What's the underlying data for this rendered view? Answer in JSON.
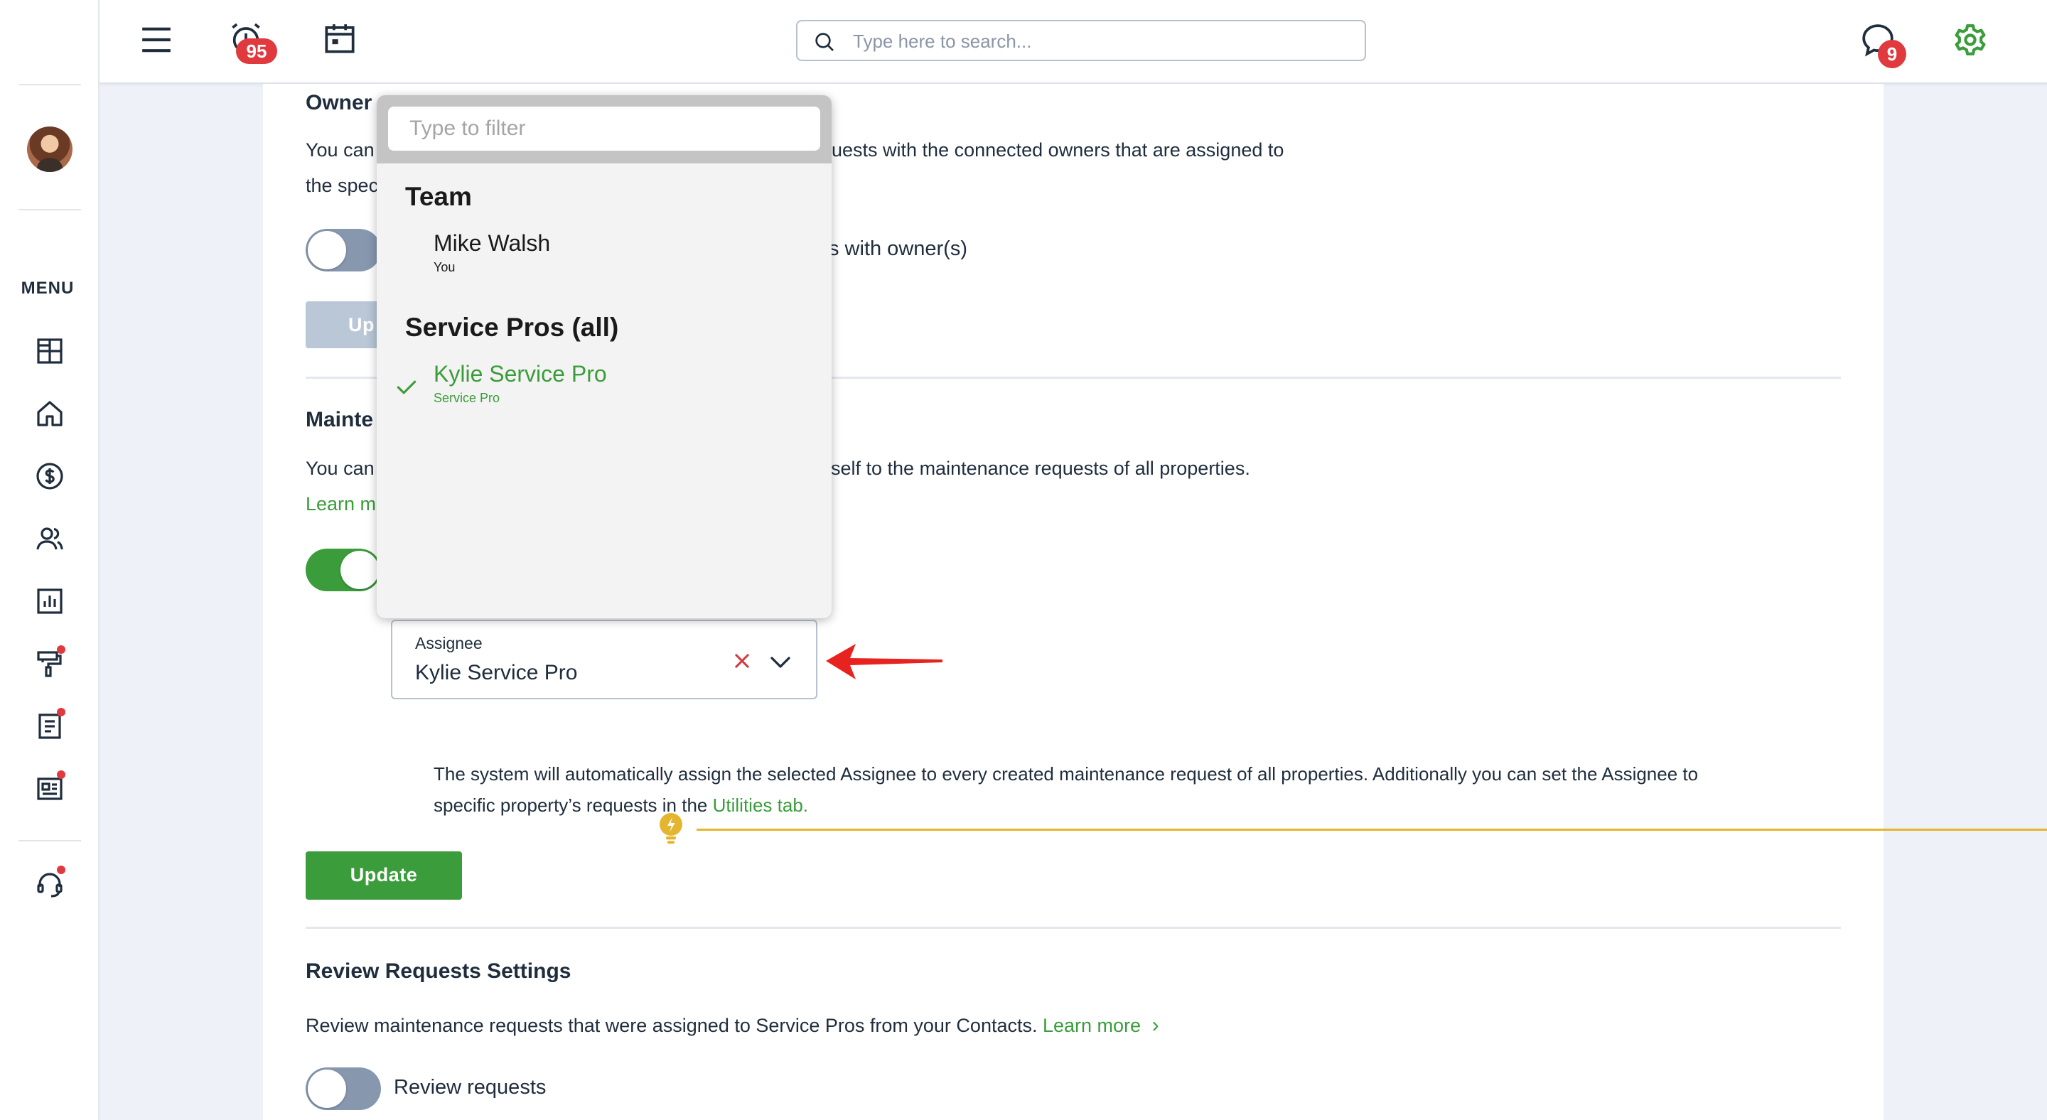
{
  "header": {
    "alarm_badge": "95",
    "chat_badge": "9",
    "search_placeholder": "Type here to search..."
  },
  "sidebar": {
    "menu_label": "MENU",
    "items": [
      {
        "icon": "dashboard-icon",
        "dot": false
      },
      {
        "icon": "home-icon",
        "dot": false
      },
      {
        "icon": "dollar-icon",
        "dot": false
      },
      {
        "icon": "people-icon",
        "dot": false
      },
      {
        "icon": "chart-icon",
        "dot": false
      },
      {
        "icon": "paint-roller-icon",
        "dot": true
      },
      {
        "icon": "document-icon",
        "dot": true
      },
      {
        "icon": "newspaper-icon",
        "dot": true
      },
      {
        "icon": "headset-icon",
        "dot": true
      }
    ]
  },
  "owner_section": {
    "title": "Owner",
    "desc_line1_left": "You can",
    "desc_line1_right": "uests with the connected owners that are assigned to",
    "desc_line2_left": "the spec",
    "toggle_label_right": "s with owner(s)",
    "button_partial": "Up"
  },
  "maintenance_section": {
    "title": "Mainte",
    "desc_left": "You can",
    "desc_right": "rself to the maintenance requests of all properties.",
    "learn_partial": "Learn m"
  },
  "assignee": {
    "label": "Assignee",
    "value": "Kylie Service Pro"
  },
  "tip": {
    "line1": "The system will automatically assign the selected Assignee to every created maintenance request of all properties. Additionally you can set the Assignee to",
    "line2_prefix": "specific property’s requests in the",
    "line2_link": "Utilities tab."
  },
  "update_button": "Update",
  "review_section": {
    "title": "Review Requests Settings",
    "desc": "Review maintenance requests that were assigned to Service Pros from your Contacts.",
    "learn_more": "Learn more",
    "toggle_label": "Review requests"
  },
  "dropdown": {
    "filter_placeholder": "Type to filter",
    "groups": [
      {
        "name": "Team",
        "options": [
          {
            "name": "Mike Walsh",
            "sub": "You",
            "selected": false
          }
        ]
      },
      {
        "name": "Service Pros (all)",
        "options": [
          {
            "name": "Kylie Service Pro",
            "sub": "Service Pro",
            "selected": true
          }
        ]
      }
    ]
  },
  "colors": {
    "green": "#3a9c3a",
    "toggle_off": "#8797ae",
    "toggle_on": "#3a9c3a",
    "badge_red": "#e0393e",
    "tip_yellow": "#e4b62f"
  }
}
